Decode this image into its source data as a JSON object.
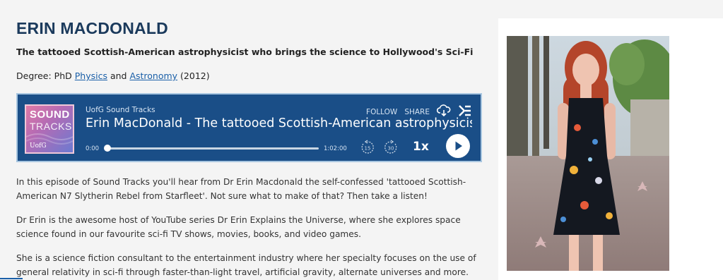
{
  "person": {
    "name": "ERIN MACDONALD",
    "tagline": "The tattooed Scottish-American astrophysicist who brings the science to Hollywood's Sci-Fi",
    "degree_prefix": "Degree: PhD ",
    "degree_link1": "Physics",
    "degree_and": " and ",
    "degree_link2": "Astronomy",
    "degree_suffix": " (2012)"
  },
  "player": {
    "cover_line1": "SOUND",
    "cover_line2": "TRACKS",
    "cover_logo": "UofG",
    "show_name": "UofG Sound Tracks",
    "episode_title": "Erin MacDonald - The tattooed Scottish-American astrophysicist",
    "follow_label": "FOLLOW",
    "share_label": "SHARE",
    "time_current": "0:00",
    "time_total": "1:02:00",
    "skip_back_label": "15",
    "skip_forward_label": "30",
    "speed": "1x",
    "progress": 0,
    "icons": [
      "download-icon",
      "podcast-logo-icon",
      "skip-back-15-icon",
      "skip-forward-30-icon",
      "play-icon"
    ],
    "colors": {
      "background": "#1a4e87",
      "border": "#a8c6e0"
    }
  },
  "body": {
    "p1": "In this episode of Sound Tracks you'll hear from Dr Erin Macdonald the self-confessed 'tattooed Scottish-American N7 Slytherin Rebel from Starfleet'. Not sure what to make of that? Then take a listen!",
    "p2": "Dr Erin is the awesome host of YouTube series Dr Erin Explains the Universe, where she explores space science found in our favourite sci-fi TV shows, movies, books, and video games.",
    "p3": "She is a science fiction consultant to the entertainment industry where her specialty focuses on the use of general relativity in sci-fi through faster-than-light travel, artificial gravity, alternate universes and more."
  },
  "colors": {
    "title": "#1b3a5c",
    "link": "#1a5fa8",
    "page_bg": "#f4f4f4"
  }
}
